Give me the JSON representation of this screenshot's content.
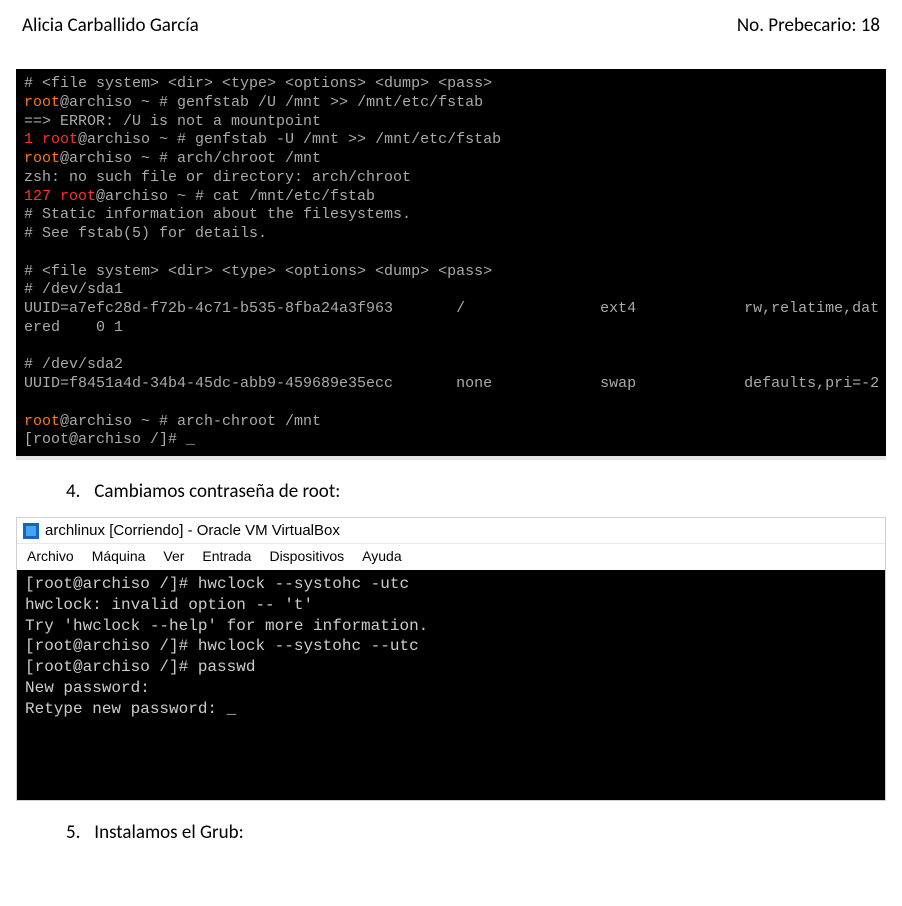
{
  "header": {
    "author": "Alicia Carballido García",
    "id_label": "No. Prebecario: 18"
  },
  "terminal1": {
    "l1_a": "# <file system> <dir> <type> <options> <dump> <pass>",
    "l2_root": "root",
    "l2_rest": "@archiso ~ # genfstab /U /mnt >> /mnt/etc/fstab",
    "l3": "==> ERROR: /U is not a mountpoint",
    "l4_code": "1 root",
    "l4_rest": "@archiso ~ # genfstab -U /mnt >> /mnt/etc/fstab",
    "l5_root": "root",
    "l5_rest": "@archiso ~ # arch/chroot /mnt",
    "l6": "zsh: no such file or directory: arch/chroot",
    "l7_code": "127 root",
    "l7_rest": "@archiso ~ # cat /mnt/etc/fstab",
    "l8": "# Static information about the filesystems.",
    "l9": "# See fstab(5) for details.",
    "l10": "",
    "l11": "# <file system> <dir> <type> <options> <dump> <pass>",
    "l12": "# /dev/sda1",
    "l13": "UUID=a7efc28d-f72b-4c71-b535-8fba24a3f963       /               ext4            rw,relatime,dat",
    "l14": "ered    0 1",
    "l15": "",
    "l16": "# /dev/sda2",
    "l17": "UUID=f8451a4d-34b4-45dc-abb9-459689e35ecc       none            swap            defaults,pri=-2",
    "l18": "",
    "l19_root": "root",
    "l19_rest": "@archiso ~ # arch-chroot /mnt",
    "l20": "[root@archiso /]# _"
  },
  "step4": {
    "num": "4.",
    "text": "Cambiamos contraseña de root:"
  },
  "vmwin": {
    "title": "archlinux [Corriendo] - Oracle VM VirtualBox",
    "menu": {
      "m1": "Archivo",
      "m2": "Máquina",
      "m3": "Ver",
      "m4": "Entrada",
      "m5": "Dispositivos",
      "m6": "Ayuda"
    },
    "body": {
      "l1": "[root@archiso /]# hwclock --systohc -utc",
      "l2": "hwclock: invalid option -- 't'",
      "l3": "Try 'hwclock --help' for more information.",
      "l4": "[root@archiso /]# hwclock --systohc --utc",
      "l5": "[root@archiso /]# passwd",
      "l6": "New password:",
      "l7": "Retype new password: _"
    }
  },
  "step5": {
    "num": "5.",
    "text": "Instalamos el Grub:"
  }
}
